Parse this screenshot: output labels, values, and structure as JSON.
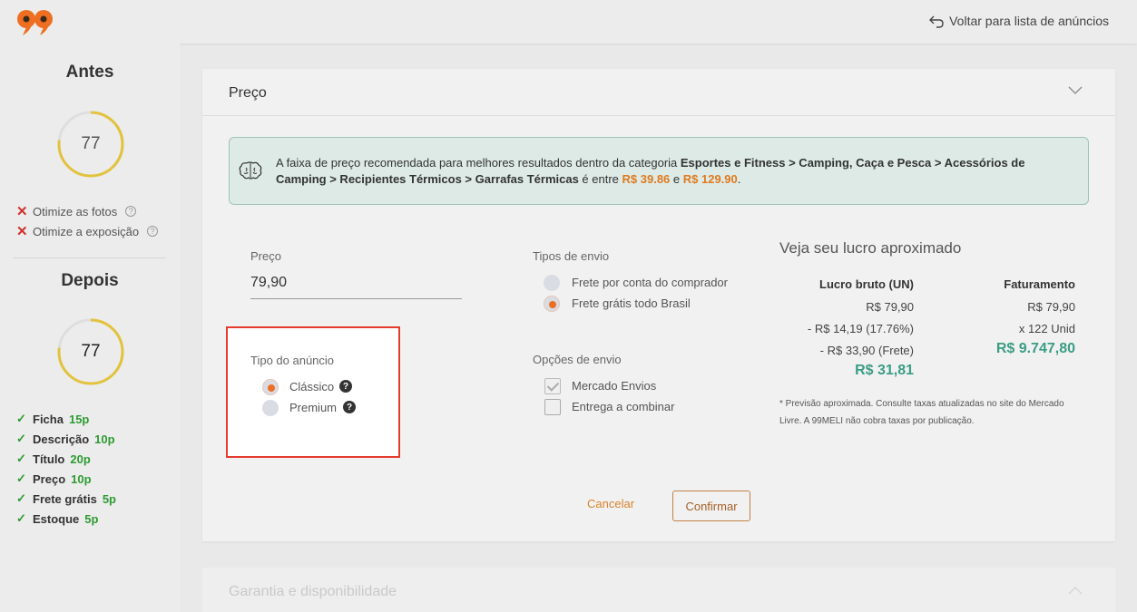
{
  "topbar": {
    "back_label": "Voltar para lista de anúncios",
    "logo_icon": "logo-99-icon",
    "brand_color": "#ee6e22"
  },
  "sidebar": {
    "before_title": "Antes",
    "before_score": "77",
    "issues": [
      {
        "label": "Otimize as fotos"
      },
      {
        "label": "Otimize a exposição"
      }
    ],
    "after_title": "Depois",
    "after_score": "77",
    "checks": [
      {
        "label": "Ficha",
        "points": "15p"
      },
      {
        "label": "Descrição",
        "points": "10p"
      },
      {
        "label": "Título",
        "points": "20p"
      },
      {
        "label": "Preço",
        "points": "10p"
      },
      {
        "label": "Frete grátis",
        "points": "5p"
      },
      {
        "label": "Estoque",
        "points": "5p"
      }
    ]
  },
  "section": {
    "title": "Preço",
    "info": {
      "prefix": "A faixa de preço recomendada para melhores resultados dentro da categoria ",
      "category": "Esportes e Fitness > Camping, Caça e Pesca > Acessórios de Camping > Recipientes Térmicos > Garrafas Térmicas",
      "middle": " é entre ",
      "min_price": "R$ 39.86",
      "and": " e ",
      "max_price": "R$ 129.90",
      "end": "."
    },
    "price_label": "Preço",
    "price_value": "79,90",
    "ad_type_label": "Tipo do anúncio",
    "ad_types": [
      {
        "label": "Clássico",
        "selected": true
      },
      {
        "label": "Premium",
        "selected": false
      }
    ],
    "shipping_types_label": "Tipos de envio",
    "shipping_types": [
      {
        "label": "Frete por conta do comprador",
        "selected": false
      },
      {
        "label": "Frete grátis todo Brasil",
        "selected": true
      }
    ],
    "shipping_options_label": "Opções de envio",
    "shipping_options": [
      {
        "label": "Mercado Envios",
        "checked": true
      },
      {
        "label": "Entrega a combinar",
        "checked": false
      }
    ],
    "profit": {
      "title": "Veja seu lucro aproximado",
      "gross_header": "Lucro bruto (UN)",
      "gross_lines": [
        "R$ 79,90",
        "- R$ 14,19 (17.76%)",
        "- R$ 33,90 (Frete)"
      ],
      "gross_total": "R$ 31,81",
      "revenue_header": "Faturamento",
      "revenue_lines": [
        "R$ 79,90",
        "x 122 Unid"
      ],
      "revenue_total": "R$ 9.747,80",
      "note": "* Previsão aproximada. Consulte taxas atualizadas no site do Mercado Livre. A 99MELI não cobra taxas por publicação."
    },
    "cancel_label": "Cancelar",
    "confirm_label": "Confirmar"
  },
  "next_section": {
    "title": "Garantia e disponibilidade"
  }
}
